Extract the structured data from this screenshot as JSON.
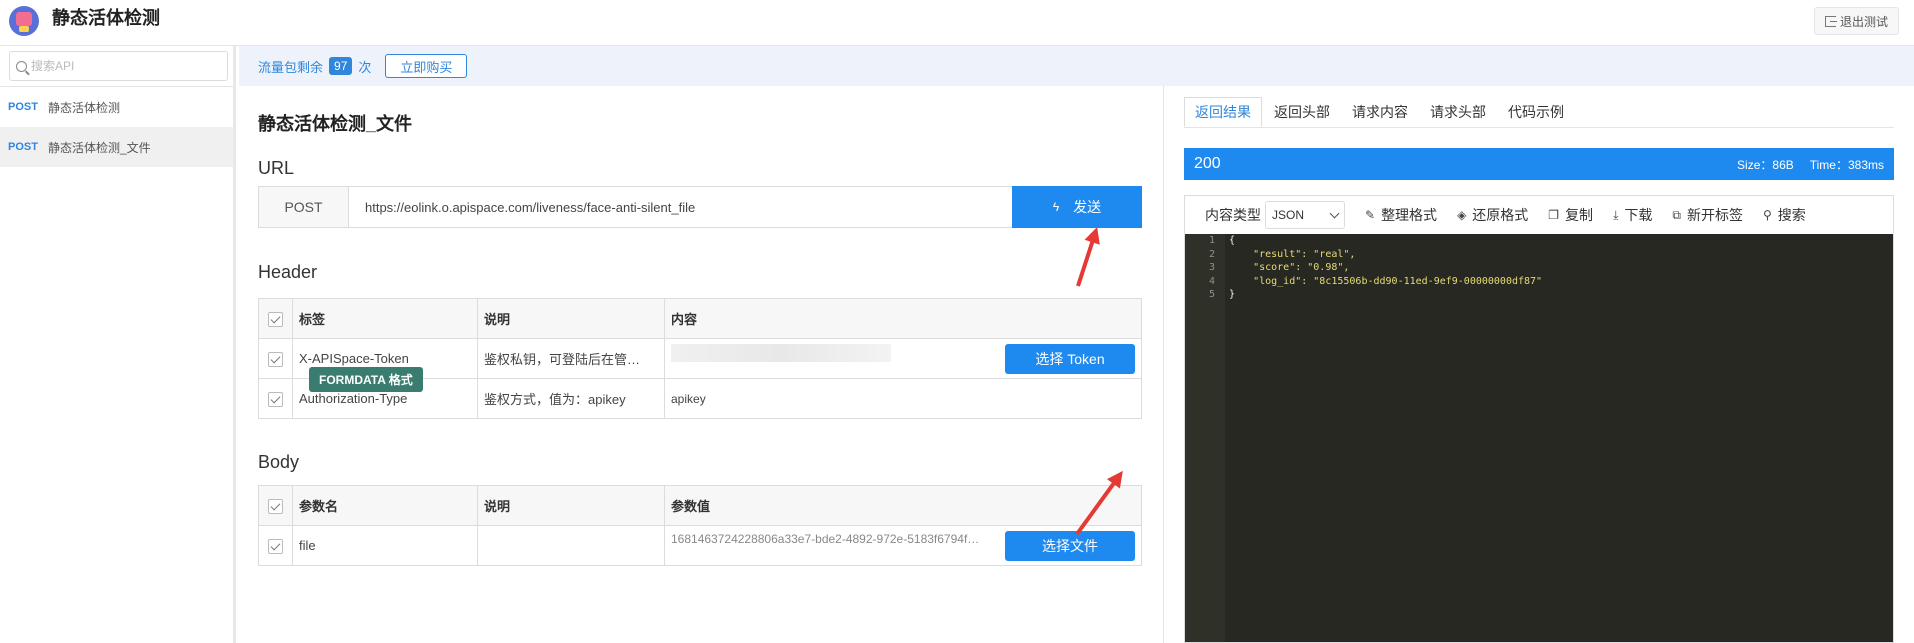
{
  "app": {
    "title": "静态活体检测",
    "exit_label": "退出测试"
  },
  "sidebar": {
    "search_placeholder": "搜索API",
    "items": [
      {
        "method": "POST",
        "label": "静态活体检测"
      },
      {
        "method": "POST",
        "label": "静态活体检测_文件"
      }
    ]
  },
  "quota": {
    "prefix": "流量包剩余",
    "count": "97",
    "suffix": "次",
    "buy_label": "立即购买"
  },
  "main": {
    "title": "静态活体检测_文件",
    "url_label": "URL",
    "method": "POST",
    "url": "https://eolink.o.apispace.com/liveness/face-anti-silent_file",
    "send_label": "发送",
    "header_label": "Header",
    "header_cols": [
      "标签",
      "说明",
      "内容"
    ],
    "header_rows": [
      {
        "name": "X-APISpace-Token",
        "desc": "鉴权私钥，可登陆后在管…",
        "button": "选择 Token"
      },
      {
        "name": "Authorization-Type",
        "desc": "鉴权方式，值为：apikey",
        "value": "apikey"
      }
    ],
    "body_label": "Body",
    "body_format": "FORMDATA 格式",
    "body_cols": [
      "参数名",
      "说明",
      "参数值"
    ],
    "body_rows": [
      {
        "name": "file",
        "desc": "",
        "value": "1681463724228806a33e7-bde2-4892-972e-5183f6794f…",
        "button": "选择文件"
      }
    ]
  },
  "response": {
    "tabs": [
      "返回结果",
      "返回头部",
      "请求内容",
      "请求头部",
      "代码示例"
    ],
    "status": "200",
    "size": "Size：86B",
    "time": "Time：383ms",
    "content_type_label": "内容类型",
    "content_type": "JSON",
    "tools": [
      "整理格式",
      "还原格式",
      "复制",
      "下载",
      "新开标签",
      "搜索"
    ],
    "line_numbers": [
      "1",
      "2",
      "3",
      "4",
      "5"
    ],
    "code_lines": [
      "{",
      "    \"result\": \"real\",",
      "    \"score\": \"0.98\",",
      "    \"log_id\": \"8c15506b-dd90-11ed-9ef9-00000000df87\"",
      "}"
    ]
  },
  "colors": {
    "accent": "#1e8af0",
    "badge": "#3a7d70",
    "editor_bg": "#272822",
    "arrow": "#e53935"
  }
}
